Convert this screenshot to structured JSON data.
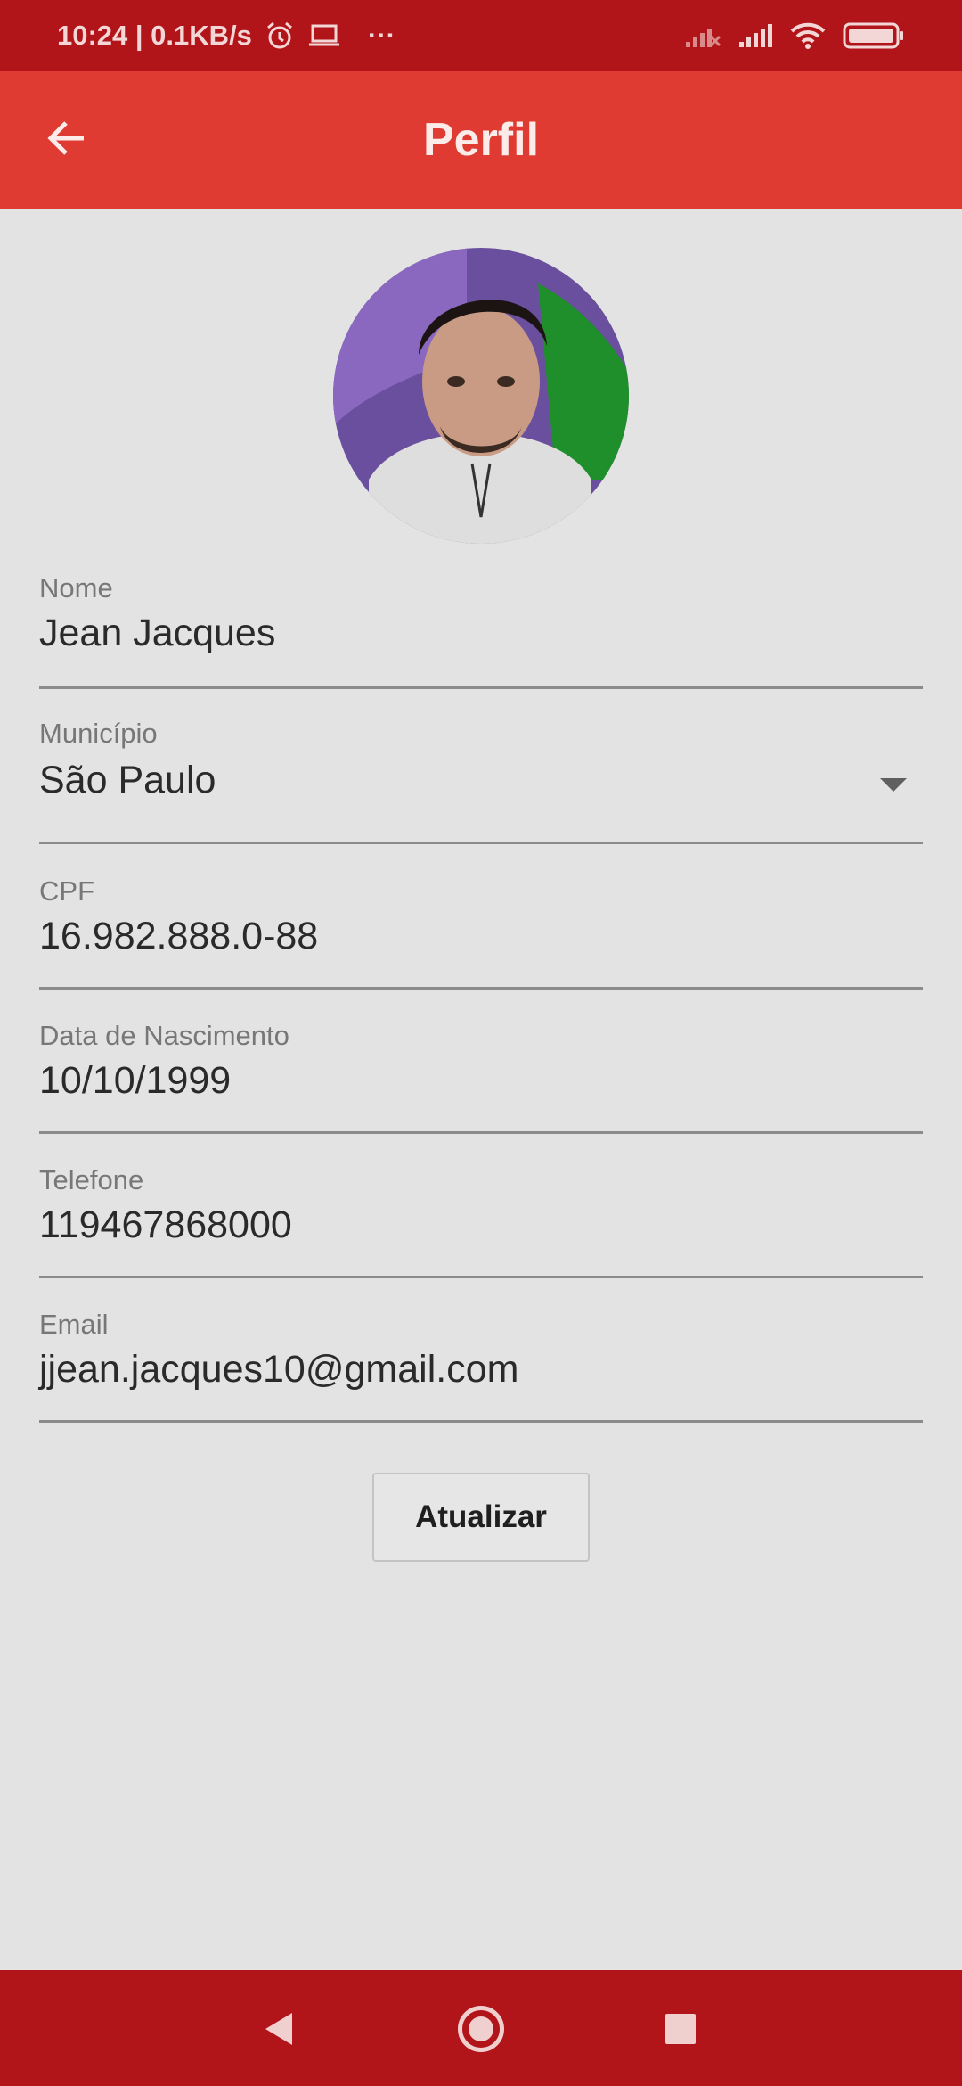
{
  "status_bar": {
    "time_speed": "10:24 | 0.1KB/s",
    "more": "···",
    "icons": [
      "alarm-icon",
      "laptop-icon",
      "signal-off-icon",
      "signal-icon",
      "wifi-icon",
      "battery-icon"
    ]
  },
  "app_bar": {
    "title": "Perfil",
    "back_icon": "arrow-left-icon"
  },
  "profile": {
    "avatar_alt": "profile photo"
  },
  "form": {
    "name": {
      "label": "Nome",
      "value": "Jean Jacques"
    },
    "city": {
      "label": "Município",
      "value": "São Paulo"
    },
    "cpf": {
      "label": "CPF",
      "value": "16.982.888.0-88"
    },
    "birth_date": {
      "label": "Data de Nascimento",
      "value": "10/10/1999"
    },
    "phone": {
      "label": "Telefone",
      "value": "119467868000"
    },
    "email": {
      "label": "Email",
      "value": "jjean.jacques10@gmail.com"
    }
  },
  "actions": {
    "update_label": "Atualizar"
  },
  "colors": {
    "status_bar": "#b11419",
    "app_bar": "#e03b32",
    "background": "#e3e3e3",
    "nav_bar": "#b11419"
  }
}
